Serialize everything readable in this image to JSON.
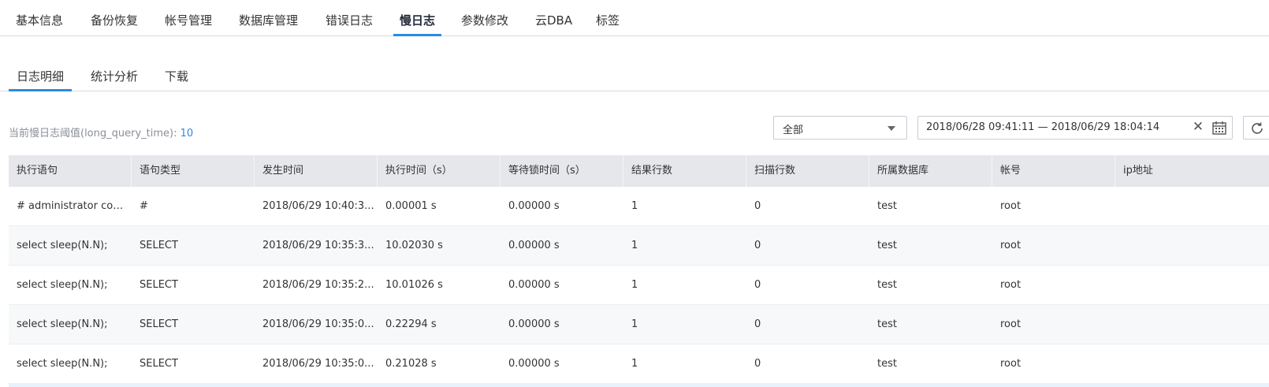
{
  "top_tabs": [
    {
      "label": "基本信息",
      "active": false
    },
    {
      "label": "备份恢复",
      "active": false
    },
    {
      "label": "帐号管理",
      "active": false
    },
    {
      "label": "数据库管理",
      "active": false
    },
    {
      "label": "错误日志",
      "active": false
    },
    {
      "label": "慢日志",
      "active": true
    },
    {
      "label": "参数修改",
      "active": false
    },
    {
      "label": "云DBA",
      "active": false
    },
    {
      "label": "标签",
      "active": false
    }
  ],
  "sub_tabs": [
    {
      "label": "日志明细",
      "active": true
    },
    {
      "label": "统计分析",
      "active": false
    },
    {
      "label": "下载",
      "active": false
    }
  ],
  "threshold": {
    "label": "当前慢日志阈值(long_query_time):",
    "value": "10"
  },
  "filter": {
    "selected": "全部"
  },
  "date_range": {
    "value": "2018/06/28 09:41:11 — 2018/06/29 18:04:14"
  },
  "table": {
    "columns": [
      "执行语句",
      "语句类型",
      "发生时间",
      "执行时间（s）",
      "等待锁时间（s）",
      "结果行数",
      "扫描行数",
      "所属数据库",
      "帐号",
      "ip地址"
    ],
    "rows": [
      [
        "# administrator com...",
        "#",
        "2018/06/29 10:40:3...",
        "0.00001 s",
        "0.00000 s",
        "1",
        "0",
        "test",
        "root",
        ""
      ],
      [
        "select sleep(N.N);",
        "SELECT",
        "2018/06/29 10:35:3...",
        "10.02030 s",
        "0.00000 s",
        "1",
        "0",
        "test",
        "root",
        ""
      ],
      [
        "select sleep(N.N);",
        "SELECT",
        "2018/06/29 10:35:2...",
        "10.01026 s",
        "0.00000 s",
        "1",
        "0",
        "test",
        "root",
        ""
      ],
      [
        "select sleep(N.N);",
        "SELECT",
        "2018/06/29 10:35:0...",
        "0.22294 s",
        "0.00000 s",
        "1",
        "0",
        "test",
        "root",
        ""
      ],
      [
        "select sleep(N.N);",
        "SELECT",
        "2018/06/29 10:35:0...",
        "0.21028 s",
        "0.00000 s",
        "1",
        "0",
        "test",
        "root",
        ""
      ]
    ]
  },
  "colors": {
    "accent": "#2b8ae3",
    "header_bg": "#e5e7ea",
    "row_alt": "#f7f8f9"
  },
  "icons": {
    "clear": "close-icon",
    "calendar": "calendar-icon",
    "refresh": "refresh-icon",
    "dropdown": "chevron-down-icon"
  }
}
